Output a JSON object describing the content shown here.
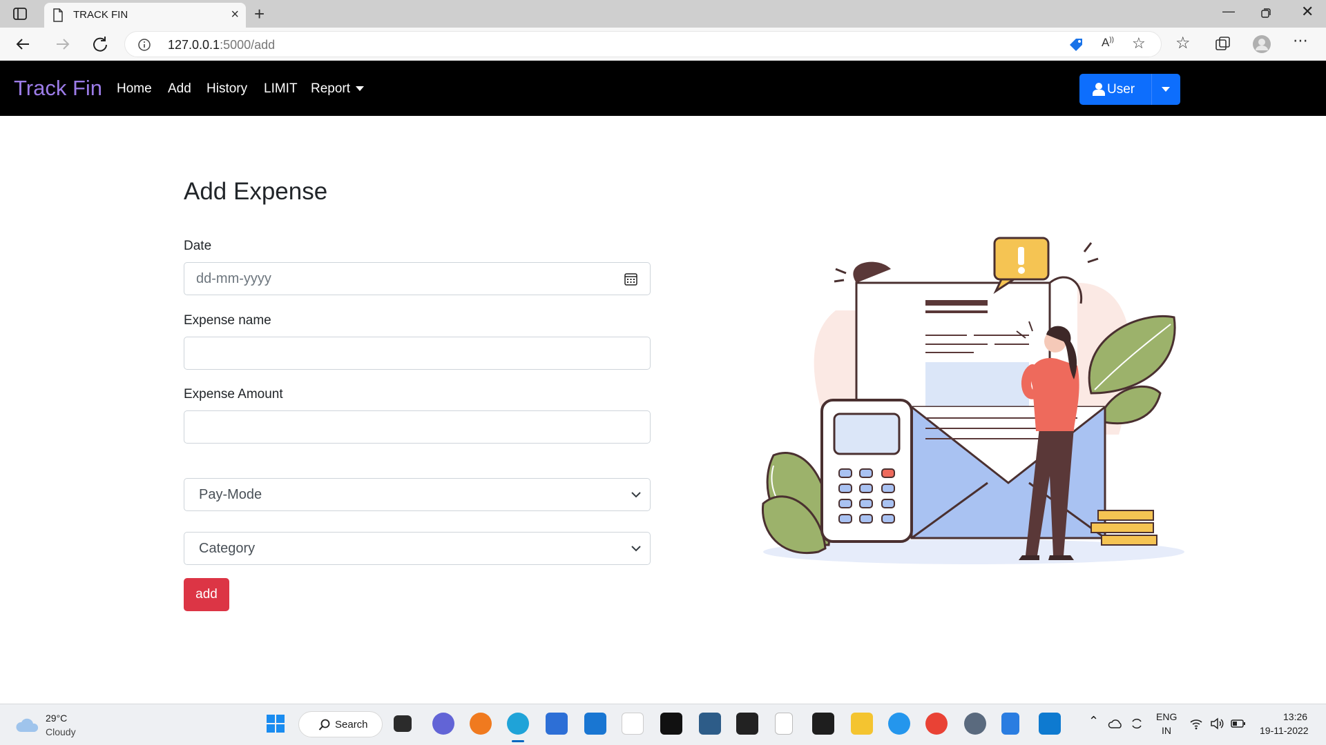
{
  "browser": {
    "tab_title": "TRACK FIN",
    "url_host": "127.0.0.1",
    "url_path": ":5000/add"
  },
  "navbar": {
    "brand": "Track Fin",
    "links": [
      "Home",
      "Add",
      "History",
      "LIMIT",
      "Report"
    ],
    "user_button": "User"
  },
  "form": {
    "title": "Add Expense",
    "date_label": "Date",
    "date_placeholder": "dd-mm-yyyy",
    "name_label": "Expense name",
    "name_value": "",
    "amount_label": "Expense Amount",
    "amount_value": "",
    "paymode_selected": "Pay-Mode",
    "category_selected": "Category",
    "submit_label": "add"
  },
  "colors": {
    "brand": "#9c7ce8",
    "primary": "#0d6efd",
    "danger": "#dc3545",
    "navbar_bg": "#000000"
  },
  "taskbar": {
    "weather_temp": "29°C",
    "weather_desc": "Cloudy",
    "search_label": "Search",
    "lang_top": "ENG",
    "lang_bottom": "IN",
    "time": "13:26",
    "date": "19-11-2022"
  }
}
